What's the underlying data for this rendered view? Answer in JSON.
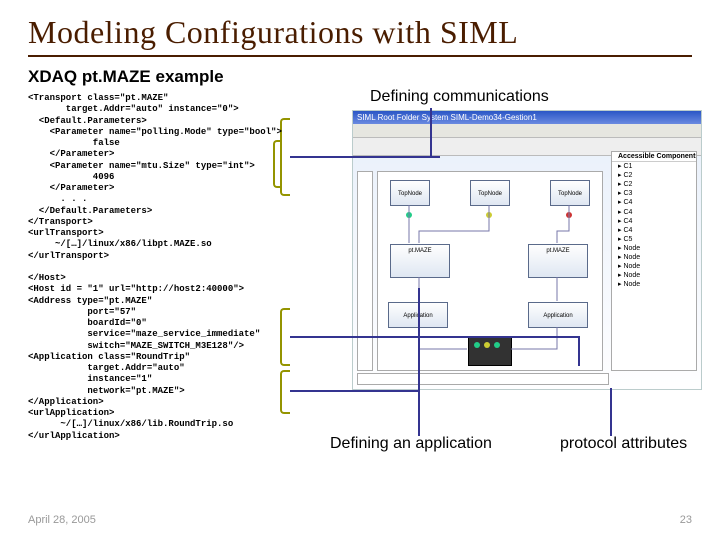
{
  "title": "Modeling Configurations with SIML",
  "subtitle": "XDAQ pt.MAZE example",
  "annotations": {
    "comms": "Defining communications",
    "app": "Defining an application",
    "proto": "protocol attributes"
  },
  "code": "<Transport class=\"pt.MAZE\"\n       target.Addr=\"auto\" instance=\"0\">\n  <Default.Parameters>\n    <Parameter name=\"polling.Mode\" type=\"bool\">\n            false\n    </Parameter>\n    <Parameter name=\"mtu.Size\" type=\"int\">\n            4096\n    </Parameter>\n      . . .\n  </Default.Parameters>\n</Transport>\n<urlTransport>\n     ~/[…]/linux/x86/libpt.MAZE.so\n</urlTransport>\n\n</Host>\n<Host id = \"1\" url=\"http://host2:40000\">\n<Address type=\"pt.MAZE\"\n           port=\"57\"\n           boardId=\"0\"\n           service=\"maze_service_immediate\"\n           switch=\"MAZE_SWITCH_M3E128\"/>\n<Application class=\"RoundTrip\"\n           target.Addr=\"auto\"\n           instance=\"1\"\n           network=\"pt.MAZE\">\n</Application>\n<urlApplication>\n      ~/[…]/linux/x86/lib.RoundTrip.so\n</urlApplication>",
  "diagram": {
    "window_title": "SIML  Root Folder  System  SIML-Demo34-Gestion1",
    "nodes": [
      "pt.MAZE",
      "pt.MAZE",
      "Application",
      "Application",
      "TopNode",
      "TopNode",
      "TopNode"
    ],
    "tree": [
      "Accessible Components",
      "▸ C1",
      "▸ C2",
      "▸ C2",
      "▸ C3",
      "▸ C4",
      "▸ C4",
      "▸ C4",
      "▸ C4",
      "▸ C5",
      "▸ Node",
      "▸ Node",
      "▸ Node",
      "▸ Node",
      "▸ Node"
    ]
  },
  "footer": {
    "date": "April 28, 2005",
    "page": "23"
  }
}
